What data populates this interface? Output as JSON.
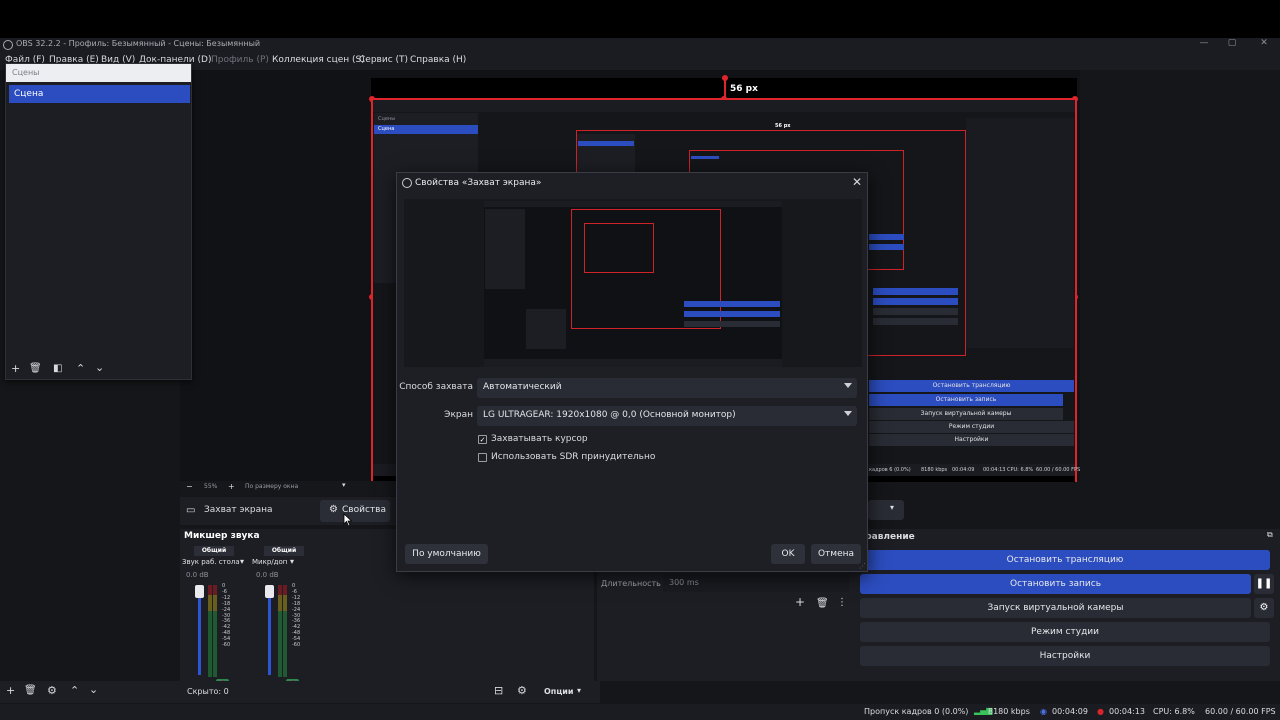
{
  "window": {
    "title": "OBS 32.2.2 - Профиль: Безымянный - Сцены: Безымянный",
    "minimize": "—",
    "maximize": "▢",
    "close": "✕"
  },
  "menubar": [
    {
      "label": "Файл (F)",
      "enabled": true
    },
    {
      "label": "Правка (E)",
      "enabled": true
    },
    {
      "label": "Вид (V)",
      "enabled": true
    },
    {
      "label": "Док-панели (D)",
      "enabled": true
    },
    {
      "label": "Профиль (P)",
      "enabled": false
    },
    {
      "label": "Коллекция сцен (S)",
      "enabled": true
    },
    {
      "label": "Сервис (T)",
      "enabled": true
    },
    {
      "label": "Справка (H)",
      "enabled": true
    }
  ],
  "preview": {
    "edge_label": "56 px",
    "zoom_text": "55%",
    "zoom_mode": "По размеру окна",
    "nested": {
      "scenes_header": "Сцены",
      "scene_item": "Сцена",
      "scene_item_small": "Сцена",
      "edge_label": "56 px",
      "buttons": [
        "Остановить трансляцию",
        "Остановить запись",
        "Запуск виртуальной камеры",
        "Режим студии",
        "Настройки"
      ],
      "status": {
        "dropped": "кадров 6 (0.0%)",
        "bitrate": "8180 kbps",
        "stream_time": "00:04:09",
        "rec_time": "00:04:13",
        "cpu": "CPU: 6.8%",
        "fps": "60.00 / 60.00 FPS"
      }
    }
  },
  "scenes": {
    "header": "Сцены",
    "items": [
      "Сцена"
    ]
  },
  "source_bar": {
    "source_name": "Захват экрана",
    "properties_button": "Свойства"
  },
  "mixer": {
    "title": "Микшер звука",
    "channels": [
      {
        "tag": "Общий",
        "name": "Звук раб. стола",
        "db": "0.0 dB"
      },
      {
        "tag": "Общий",
        "name": "Микр/доп",
        "db": "0.0 dB"
      }
    ],
    "scale": [
      "0",
      "-6",
      "-12",
      "-18",
      "-24",
      "-30",
      "-36",
      "-42",
      "-48",
      "-54",
      "-60"
    ]
  },
  "bottom_tools": {
    "hidden": "Скрыто: 0",
    "options": "Опции"
  },
  "transitions": {
    "duration_label": "Длительность",
    "duration_value": "300 ms"
  },
  "controls": {
    "title_partial": "правление",
    "buttons": [
      {
        "label": "Остановить трансляцию",
        "active": true
      },
      {
        "label": "Остановить запись",
        "active": true
      },
      {
        "label": "Запуск виртуальной камеры",
        "active": false
      },
      {
        "label": "Режим студии",
        "active": false
      },
      {
        "label": "Настройки",
        "active": false
      }
    ]
  },
  "dialog": {
    "title": "Свойства «Захват экрана»",
    "capture_method_label": "Способ захвата",
    "capture_method_value": "Автоматический",
    "screen_label": "Экран",
    "screen_value": "LG ULTRAGEAR: 1920x1080 @ 0,0 (Основной монитор)",
    "capture_cursor_label": "Захватывать курсор",
    "capture_cursor_checked": true,
    "force_sdr_label": "Использовать SDR принудительно",
    "force_sdr_checked": false,
    "defaults_button": "По умолчанию",
    "ok_button": "OK",
    "cancel_button": "Отмена"
  },
  "statusbar": {
    "dropped": "Пропуск кадров 0 (0.0%)",
    "bitrate": "8180 kbps",
    "stream_time": "00:04:09",
    "rec_time": "00:04:13",
    "cpu": "CPU: 6.8%",
    "fps": "60.00 / 60.00 FPS"
  },
  "colors": {
    "accent_blue": "#2c4dbf",
    "selection_red": "#e0242c",
    "panel_bg": "#1d1e24",
    "live_green": "#2a8a4a"
  }
}
